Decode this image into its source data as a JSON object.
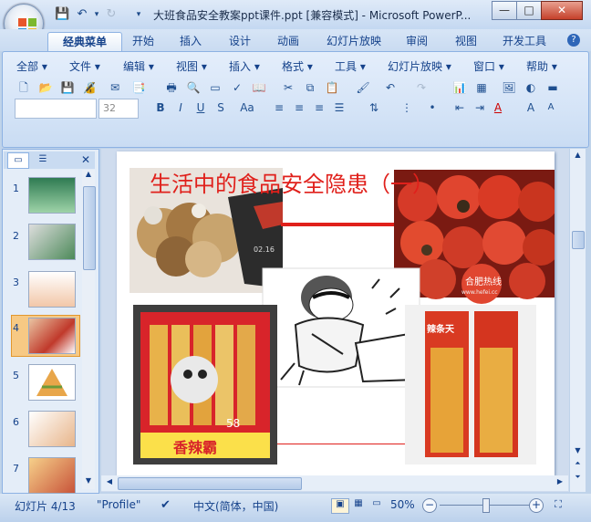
{
  "window": {
    "title": "大班食品安全教案ppt课件.ppt [兼容模式] - Microsoft PowerP...",
    "buttons": {
      "minimize": "—",
      "maximize": "□",
      "close": "✕"
    }
  },
  "ribbon_tabs": [
    "经典菜单",
    "开始",
    "插入",
    "设计",
    "动画",
    "幻灯片放映",
    "审阅",
    "视图",
    "开发工具"
  ],
  "classic_menus": [
    "全部",
    "文件",
    "编辑",
    "视图",
    "插入",
    "格式",
    "工具",
    "幻灯片放映",
    "窗口",
    "帮助"
  ],
  "toolbar": {
    "font_name": "",
    "font_size": "32"
  },
  "format_buttons": [
    "B",
    "I",
    "U",
    "S",
    "Aa"
  ],
  "slide_thumbnails": [
    {
      "num": "1",
      "selected": false
    },
    {
      "num": "2",
      "selected": false
    },
    {
      "num": "3",
      "selected": false
    },
    {
      "num": "4",
      "selected": true
    },
    {
      "num": "5",
      "selected": false
    },
    {
      "num": "6",
      "selected": false
    },
    {
      "num": "7",
      "selected": false
    }
  ],
  "slide": {
    "title": "生活中的食品安全隐患（一）",
    "title_color": "#e0201b",
    "watermark": "合肥热线",
    "watermark_url": "www.hefei.cc",
    "snack_brand": "辣条天",
    "snack_label": "香辣霸",
    "snack_number": "58",
    "fig_number": "02.16"
  },
  "status": {
    "slide_info": "幻灯片 4/13",
    "theme": "\"Profile\"",
    "language": "中文(简体，中国)",
    "zoom": "50%",
    "zoom_fraction": 0.5
  },
  "colors": {
    "accent": "#15428b",
    "selected_thumb": "#f7c984"
  }
}
